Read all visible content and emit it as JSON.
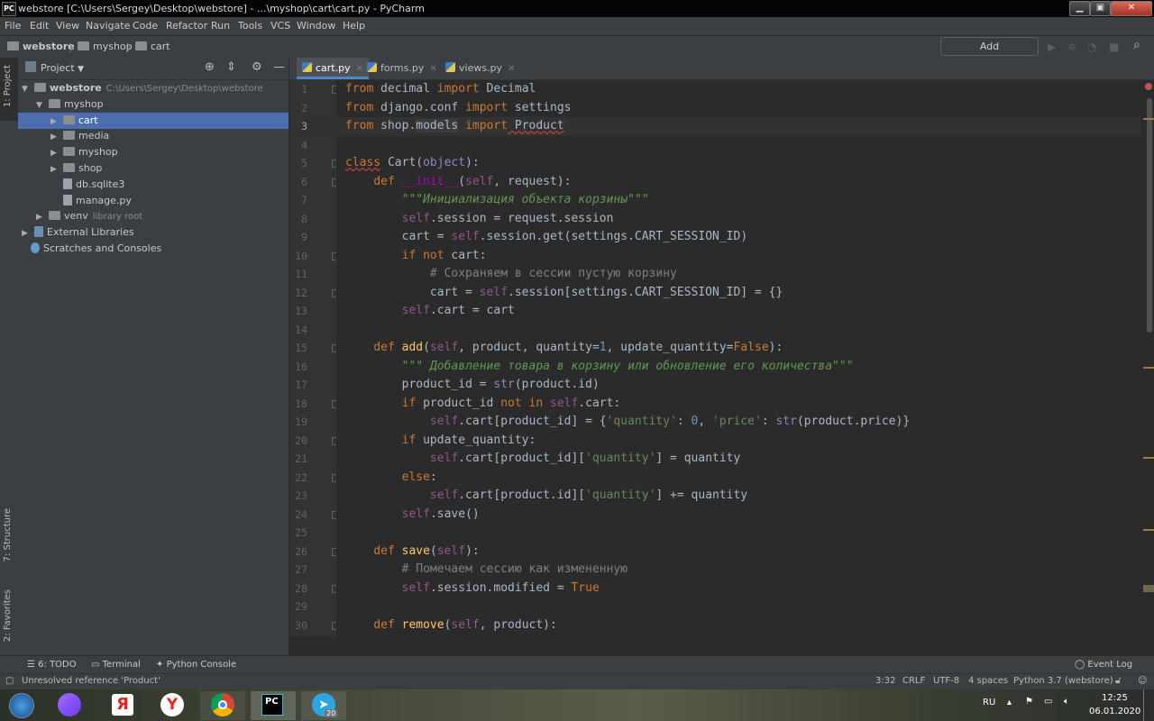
{
  "window": {
    "title": "webstore [C:\\Users\\Sergey\\Desktop\\webstore] - ...\\myshop\\cart\\cart.py - PyCharm",
    "app_icon_text": "PC",
    "controls": [
      "minimize-icon",
      "maximize-icon",
      "close-icon"
    ]
  },
  "menu": [
    "File",
    "Edit",
    "View",
    "Navigate",
    "Code",
    "Refactor",
    "Run",
    "Tools",
    "VCS",
    "Window",
    "Help"
  ],
  "breadcrumb": [
    "webstore",
    "myshop",
    "cart"
  ],
  "toolbar": {
    "add_configuration": "Add Configuration..."
  },
  "left_strip": {
    "project": "1: Project",
    "structure": "7: Structure",
    "favorites": "2: Favorites"
  },
  "project_panel": {
    "title": "Project",
    "tree": [
      {
        "label": "webstore",
        "hint": "C:\\Users\\Sergey\\Desktop\\webstore",
        "depth": 0,
        "kind": "folder",
        "expanded": true
      },
      {
        "label": "myshop",
        "hint": "",
        "depth": 1,
        "kind": "folder",
        "expanded": true
      },
      {
        "label": "cart",
        "hint": "",
        "depth": 2,
        "kind": "folder",
        "expanded": false,
        "selected": true
      },
      {
        "label": "media",
        "hint": "",
        "depth": 2,
        "kind": "folder",
        "expanded": false
      },
      {
        "label": "myshop",
        "hint": "",
        "depth": 2,
        "kind": "folder",
        "expanded": false
      },
      {
        "label": "shop",
        "hint": "",
        "depth": 2,
        "kind": "folder",
        "expanded": false
      },
      {
        "label": "db.sqlite3",
        "hint": "",
        "depth": 2,
        "kind": "file"
      },
      {
        "label": "manage.py",
        "hint": "",
        "depth": 2,
        "kind": "file"
      },
      {
        "label": "venv",
        "hint": "library root",
        "depth": 1,
        "kind": "folder",
        "expanded": false
      },
      {
        "label": "External Libraries",
        "hint": "",
        "depth": 0,
        "kind": "lib",
        "expanded": false
      },
      {
        "label": "Scratches and Consoles",
        "hint": "",
        "depth": 0,
        "kind": "scratch"
      }
    ]
  },
  "tabs": [
    {
      "label": "cart.py",
      "active": true
    },
    {
      "label": "forms.py",
      "active": false
    },
    {
      "label": "views.py",
      "active": false
    }
  ],
  "code_lines": [
    "1",
    "2",
    "3",
    "4",
    "5",
    "6",
    "7",
    "8",
    "9",
    "10",
    "11",
    "12",
    "13",
    "14",
    "15",
    "16",
    "17",
    "18",
    "19",
    "20",
    "21",
    "22",
    "23",
    "24",
    "25",
    "26",
    "27",
    "28",
    "29",
    "30"
  ],
  "code": {
    "l1": [
      "from",
      " decimal ",
      "import",
      " Decimal"
    ],
    "l2": [
      "from",
      " django.conf ",
      "import",
      " settings"
    ],
    "l3": [
      "from",
      " shop.",
      "models",
      " ",
      "import",
      " Product"
    ],
    "l5": [
      "class",
      " Cart(",
      "object",
      "):"
    ],
    "l6": [
      "def",
      " ",
      "__init__",
      "(",
      "self",
      ", request):"
    ],
    "l7": "\"\"\"Инициализация объекта корзины\"\"\"",
    "l8": [
      "self",
      ".session = request.session"
    ],
    "l9": [
      "cart = ",
      "self",
      ".session.get(settings.CART_SESSION_ID)"
    ],
    "l10": [
      "if not",
      " cart:"
    ],
    "l11": "# Сохраняем в сессии пустую корзину",
    "l12": [
      "cart = ",
      "self",
      ".session[settings.CART_SESSION_ID] = {}"
    ],
    "l13": [
      "self",
      ".cart = cart"
    ],
    "l15": [
      "def",
      " ",
      "add",
      "(",
      "self",
      ", product, quantity=",
      "1",
      ", update_quantity=",
      "False",
      "):"
    ],
    "l16": "\"\"\" Добавление товара в корзину или обновление его количества\"\"\"",
    "l17": [
      "product_id = ",
      "str",
      "(product.id)"
    ],
    "l18": [
      "if",
      " product_id ",
      "not in",
      " ",
      "self",
      ".cart:"
    ],
    "l19": [
      "self",
      ".cart[product_id] = {",
      "'quantity'",
      ": ",
      "0",
      ", ",
      "'price'",
      ": ",
      "str",
      "(product.price)}"
    ],
    "l20": [
      "if",
      " update_quantity:"
    ],
    "l21": [
      "self",
      ".cart[product_id][",
      "'quantity'",
      "] = quantity"
    ],
    "l22": [
      "else",
      ":"
    ],
    "l23": [
      "self",
      ".cart[product.id][",
      "'quantity'",
      "] += quantity"
    ],
    "l24": [
      "self",
      ".save()"
    ],
    "l26": [
      "def",
      " ",
      "save",
      "(",
      "self",
      "):"
    ],
    "l27": "# Помечаем сессию как измененную",
    "l28": [
      "self",
      ".session.modified = ",
      "True"
    ],
    "l30": [
      "def",
      " ",
      "remove",
      "(",
      "self",
      ", product):"
    ]
  },
  "bottom_tools": [
    "6: TODO",
    "Terminal",
    "Python Console",
    "Event Log"
  ],
  "status": {
    "message": "Unresolved reference 'Product'",
    "position": "3:32",
    "line_sep": "CRLF",
    "encoding": "UTF-8",
    "indent": "4 spaces",
    "interpreter": "Python 3.7 (webstore)"
  },
  "taskbar": {
    "apps": [
      "windows-start",
      "alice",
      "yandex",
      "yandex-browser",
      "chrome",
      "pycharm",
      "telegram"
    ],
    "telegram_badge": "20",
    "lang": "RU",
    "time": "12:25",
    "date": "06.01.2020"
  },
  "colors": {
    "selection": "#4b6eaf",
    "keyword": "#cc7832",
    "string": "#6a8759",
    "self": "#94558d",
    "number": "#6897bb"
  }
}
